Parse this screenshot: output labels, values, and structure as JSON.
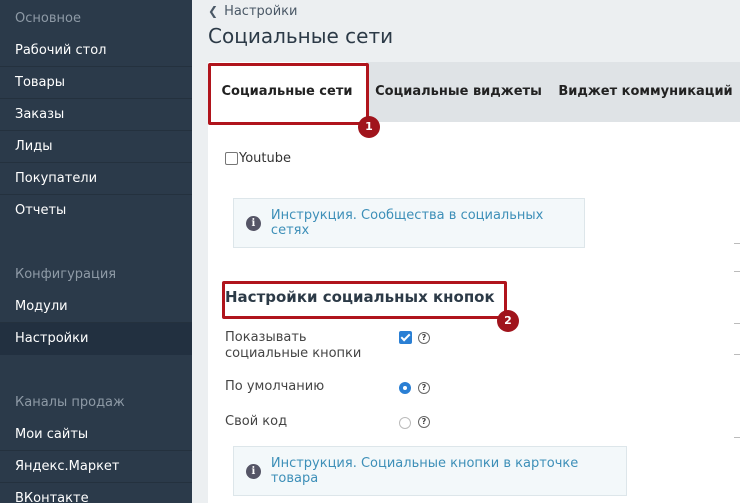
{
  "sidebar": {
    "sections": [
      {
        "label": "Основное"
      },
      {
        "label": "Конфигурация"
      },
      {
        "label": "Каналы продаж"
      }
    ],
    "items": [
      {
        "label": "Рабочий стол"
      },
      {
        "label": "Товары"
      },
      {
        "label": "Заказы"
      },
      {
        "label": "Лиды"
      },
      {
        "label": "Покупатели"
      },
      {
        "label": "Отчеты"
      },
      {
        "label": "Модули"
      },
      {
        "label": "Настройки"
      },
      {
        "label": "Мои сайты"
      },
      {
        "label": "Яндекс.Маркет"
      },
      {
        "label": "ВКонтакте"
      }
    ]
  },
  "header": {
    "back_label": "Настройки",
    "title": "Социальные сети"
  },
  "tabs": [
    {
      "label": "Социальные сети"
    },
    {
      "label": "Социальные виджеты"
    },
    {
      "label": "Виджет коммуникаций"
    }
  ],
  "content": {
    "youtube_label": "Youtube",
    "info1_link": "Инструкция. Сообщества в социальных сетях",
    "section_heading": "Настройки социальных кнопок",
    "show_buttons_label_line1": "Показывать",
    "show_buttons_label_line2": "социальные кнопки",
    "default_label": "По умолчанию",
    "custom_code_label": "Свой код",
    "info2_link": "Инструкция. Социальные кнопки в карточке товара",
    "help_glyph": "?"
  },
  "annotations": {
    "badge1": "1",
    "badge2": "2"
  },
  "colors": {
    "sidebar_bg": "#2b3a4a",
    "accent": "#2a7fd4",
    "link": "#3d8fb8",
    "annotation": "#b0141c"
  }
}
